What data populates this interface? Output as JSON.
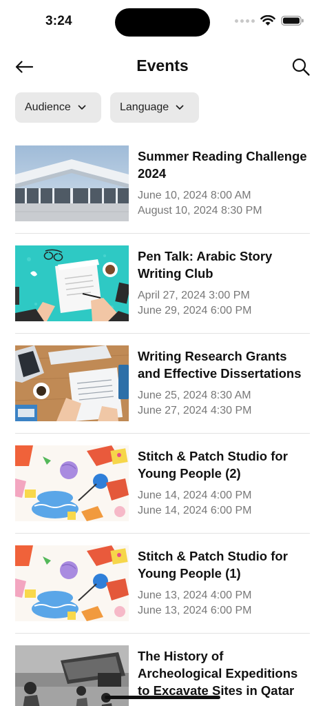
{
  "status": {
    "time": "3:24"
  },
  "header": {
    "title": "Events",
    "back_icon": "arrow-left-icon",
    "search_icon": "search-icon"
  },
  "filters": [
    {
      "label": "Audience",
      "icon": "chevron-down-icon"
    },
    {
      "label": "Language",
      "icon": "chevron-down-icon"
    }
  ],
  "events": [
    {
      "title": "Summer Reading Challenge 2024",
      "start": "June 10, 2024 8:00 AM",
      "end": "August 10, 2024 8:30 PM",
      "image": "library-building"
    },
    {
      "title": "Pen Talk: Arabic Story Writing Club",
      "start": "April 27, 2024 3:00 PM",
      "end": "June 29, 2024 6:00 PM",
      "image": "writing-desk-teal"
    },
    {
      "title": "Writing Research Grants and Effective Dissertations",
      "start": "June 25, 2024 8:30 AM",
      "end": "June 27, 2024 4:30 PM",
      "image": "desk-documents"
    },
    {
      "title": "Stitch & Patch Studio for Young People (2)",
      "start": "June 14, 2024 4:00 PM",
      "end": "June 14, 2024 6:00 PM",
      "image": "sewing-illustration"
    },
    {
      "title": "Stitch & Patch Studio for Young People (1)",
      "start": "June 13, 2024 4:00 PM",
      "end": "June 13, 2024 6:00 PM",
      "image": "sewing-illustration"
    },
    {
      "title": "The History of Archeological Expeditions to Excavate Sites in Qatar",
      "start": "",
      "end": "",
      "image": "archeology-photo"
    }
  ],
  "colors": {
    "chip_bg": "#e9e9e9",
    "date_text": "#777777",
    "divider": "#e2e2e2"
  }
}
